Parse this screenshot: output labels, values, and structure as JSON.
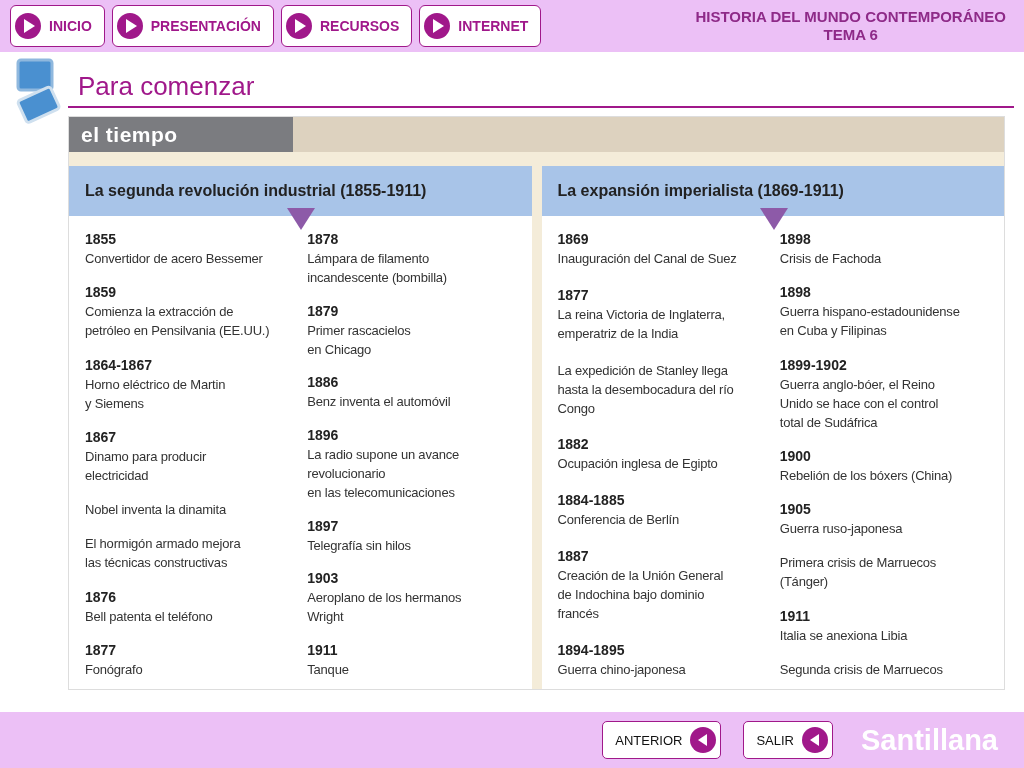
{
  "nav_buttons": [
    {
      "label": "INICIO"
    },
    {
      "label": "PRESENTACIÓN"
    },
    {
      "label": "RECURSOS"
    },
    {
      "label": "INTERNET"
    }
  ],
  "course_title": "HISTORIA DEL MUNDO CONTEMPORÁNEO",
  "course_subtitle": "TEMA 6",
  "page_title": "Para comenzar",
  "section_tab": "el tiempo",
  "panels": [
    {
      "title": "La segunda revolución industrial (1855-1911)",
      "columns": [
        [
          {
            "year": "1855",
            "text": "Convertidor de acero Bessemer"
          },
          {
            "year": "1859",
            "text": "Comienza la extracción de\npetróleo en Pensilvania (EE.UU.)"
          },
          {
            "year": "1864-1867",
            "text": "Horno eléctrico de Martin\ny Siemens"
          },
          {
            "year": "1867",
            "text": "Dinamo para producir\nelectricidad"
          },
          {
            "text": "Nobel inventa la dinamita"
          },
          {
            "text": "El hormigón armado mejora\nlas técnicas constructivas"
          },
          {
            "year": "1876",
            "text": "Bell patenta el teléfono"
          },
          {
            "year": "1877",
            "text": "Fonógrafo"
          }
        ],
        [
          {
            "year": "1878",
            "text": "Lámpara de filamento\nincandescente (bombilla)"
          },
          {
            "year": "1879",
            "text": "Primer rascacielos\nen Chicago"
          },
          {
            "year": "1886",
            "text": "Benz inventa el automóvil"
          },
          {
            "year": "1896",
            "text": "La radio supone un avance\nrevolucionario\nen las telecomunicaciones"
          },
          {
            "year": "1897",
            "text": "Telegrafía sin hilos"
          },
          {
            "year": "1903",
            "text": "Aeroplano  de los hermanos\nWright"
          },
          {
            "year": "1911",
            "text": "Tanque"
          }
        ]
      ]
    },
    {
      "title": "La expansión imperialista (1869-1911)",
      "columns": [
        [
          {
            "year": "1869",
            "text": "Inauguración del Canal de Suez"
          },
          {
            "year": "1877",
            "text": "La reina Victoria de Inglaterra,\nemperatriz de la India"
          },
          {
            "text": "La expedición de Stanley llega\nhasta la desembocadura del río\nCongo"
          },
          {
            "year": "1882",
            "text": "Ocupación inglesa de Egipto"
          },
          {
            "year": "1884-1885",
            "text": "Conferencia de Berlín"
          },
          {
            "year": "1887",
            "text": "Creación de la Unión General\nde Indochina bajo dominio\nfrancés"
          },
          {
            "year": "1894-1895",
            "text": "Guerra chino-japonesa"
          }
        ],
        [
          {
            "year": "1898",
            "text": "Crisis de Fachoda"
          },
          {
            "year": "1898",
            "text": "Guerra hispano-estadounidense\nen Cuba y Filipinas"
          },
          {
            "year": "1899-1902",
            "text": "Guerra anglo-bóer, el Reino\nUnido se hace con el control\ntotal de Sudáfrica"
          },
          {
            "year": "1900",
            "text": "Rebelión de los bóxers (China)"
          },
          {
            "year": "1905",
            "text": "Guerra ruso-japonesa"
          },
          {
            "text": "Primera crisis de Marruecos\n(Tánger)"
          },
          {
            "year": "1911",
            "text": "Italia se anexiona Libia"
          },
          {
            "text": "Segunda crisis de Marruecos"
          }
        ]
      ]
    }
  ],
  "footer_buttons": [
    {
      "label": "ANTERIOR"
    },
    {
      "label": "SALIR"
    }
  ],
  "brand": "Santillana"
}
